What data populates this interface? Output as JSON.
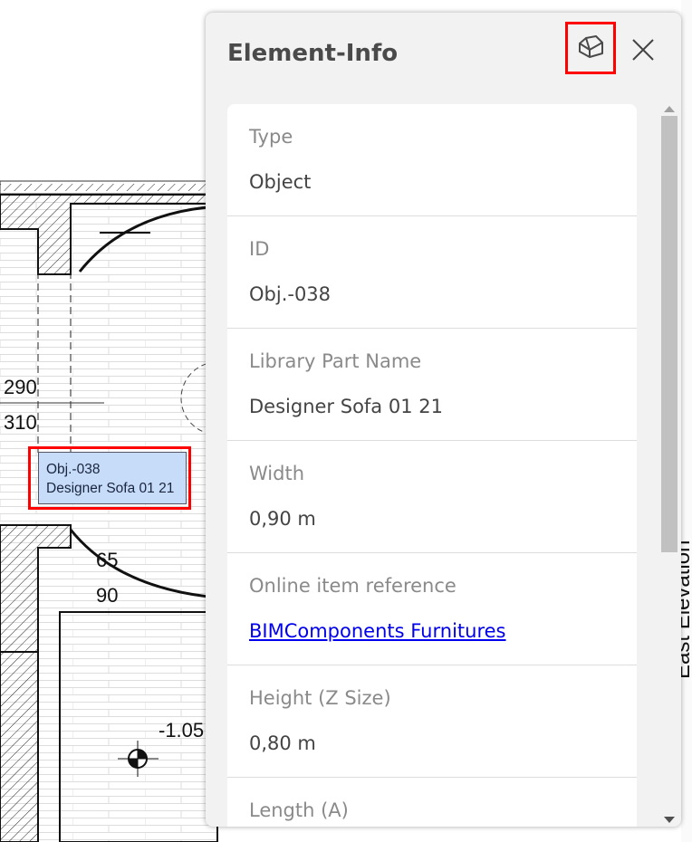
{
  "plan": {
    "dimensions": [
      "290",
      "310",
      "65",
      "90",
      "-1.05"
    ],
    "selection_tag": {
      "line1": "Obj.-038",
      "line2": "Designer Sofa 01 21"
    },
    "side_label": "East Elevation"
  },
  "panel": {
    "title": "Element-Info",
    "rows": [
      {
        "label": "Type",
        "value": "Object"
      },
      {
        "label": "ID",
        "value": "Obj.-038"
      },
      {
        "label": "Library Part Name",
        "value": "Designer Sofa 01 21"
      },
      {
        "label": "Width",
        "value": "0,90 m"
      },
      {
        "label": "Online item reference",
        "value": "BIMComponents Furnitures"
      },
      {
        "label": "Height (Z Size)",
        "value": "0,80 m"
      },
      {
        "label": "Length (A)",
        "value": ""
      }
    ]
  }
}
